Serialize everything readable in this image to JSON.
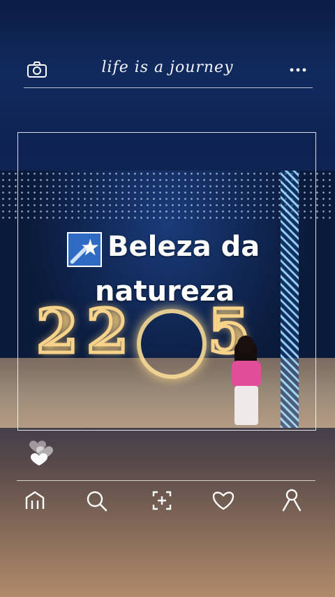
{
  "header": {
    "title": "life is a journey",
    "camera_icon": "camera-icon",
    "more_icon": "more-dots-icon"
  },
  "post": {
    "caption_line1": "Beleza da",
    "caption_line2": "natureza",
    "badge_icon": "shooting-star-icon",
    "photo_numbers": [
      "2",
      "0",
      "2",
      "5"
    ]
  },
  "reactions": {
    "icon": "hearts-icon"
  },
  "nav": {
    "items": [
      {
        "name": "home",
        "icon": "home-icon"
      },
      {
        "name": "search",
        "icon": "search-icon"
      },
      {
        "name": "add",
        "icon": "add-photo-icon"
      },
      {
        "name": "likes",
        "icon": "heart-icon"
      },
      {
        "name": "profile",
        "icon": "profile-icon"
      }
    ]
  },
  "colors": {
    "accent_pink": "#e04e9a",
    "badge_blue": "#2f6bc4",
    "lights_gold": "#f6d28a"
  }
}
